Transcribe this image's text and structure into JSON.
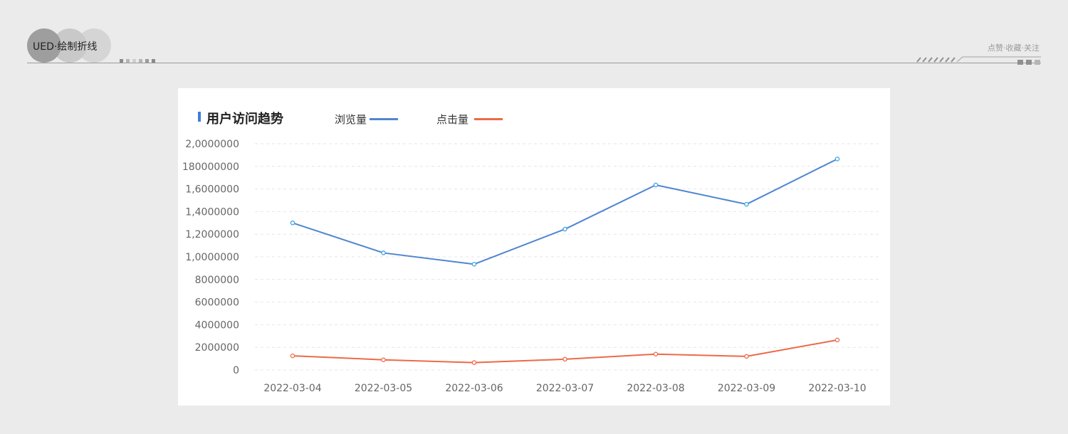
{
  "header": {
    "badge_text": "UED·绘制折线",
    "right_text": "点赞·收藏·关注"
  },
  "colors": {
    "browse": "#4f86d0",
    "click": "#ec6a49",
    "title_accent": "#3d7fd6"
  },
  "chart_data": {
    "type": "line",
    "title": "用户访问趋势",
    "categories": [
      "2022-03-04",
      "2022-03-05",
      "2022-03-06",
      "2022-03-07",
      "2022-03-08",
      "2022-03-09",
      "2022-03-10"
    ],
    "y_tick_labels": [
      "0",
      "2000000",
      "4000000",
      "6000000",
      "8000000",
      "1,0000000",
      "1,2000000",
      "1,4000000",
      "1,6000000",
      "180000000",
      "2,0000000"
    ],
    "ylim": [
      0,
      20000000
    ],
    "grid": true,
    "legend_position": "top",
    "series": [
      {
        "name": "浏览量",
        "values": [
          13000000,
          10350000,
          9350000,
          12450000,
          16350000,
          14650000,
          18650000
        ]
      },
      {
        "name": "点击量",
        "values": [
          1250000,
          900000,
          650000,
          950000,
          1400000,
          1200000,
          2650000
        ]
      }
    ]
  }
}
